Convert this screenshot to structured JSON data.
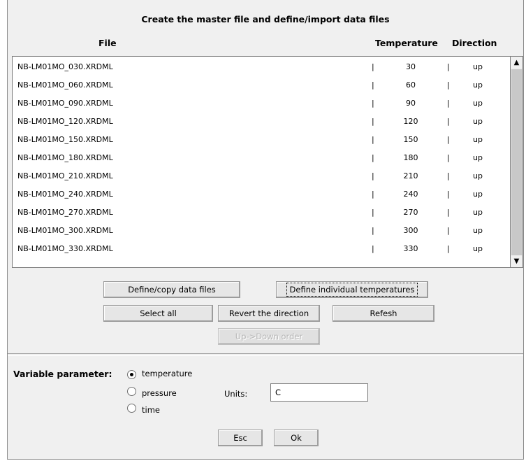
{
  "dialog": {
    "title": "Create the master file and define/import data files",
    "columns": {
      "file": "File",
      "temperature": "Temperature",
      "direction": "Direction"
    }
  },
  "rows": [
    {
      "file": "NB-LM01MO_030.XRDML",
      "temperature": "30",
      "direction": "up"
    },
    {
      "file": "NB-LM01MO_060.XRDML",
      "temperature": "60",
      "direction": "up"
    },
    {
      "file": "NB-LM01MO_090.XRDML",
      "temperature": "90",
      "direction": "up"
    },
    {
      "file": "NB-LM01MO_120.XRDML",
      "temperature": "120",
      "direction": "up"
    },
    {
      "file": "NB-LM01MO_150.XRDML",
      "temperature": "150",
      "direction": "up"
    },
    {
      "file": "NB-LM01MO_180.XRDML",
      "temperature": "180",
      "direction": "up"
    },
    {
      "file": "NB-LM01MO_210.XRDML",
      "temperature": "210",
      "direction": "up"
    },
    {
      "file": "NB-LM01MO_240.XRDML",
      "temperature": "240",
      "direction": "up"
    },
    {
      "file": "NB-LM01MO_270.XRDML",
      "temperature": "270",
      "direction": "up"
    },
    {
      "file": "NB-LM01MO_300.XRDML",
      "temperature": "300",
      "direction": "up"
    },
    {
      "file": "NB-LM01MO_330.XRDML",
      "temperature": "330",
      "direction": "up"
    }
  ],
  "buttons": {
    "define_copy": "Define/copy data files",
    "define_temps": "Define individual temperatures",
    "select_all": "Select all",
    "revert": "Revert the direction",
    "refresh": "Refesh",
    "up_down": "Up->Down order",
    "esc": "Esc",
    "ok": "Ok"
  },
  "variable": {
    "label": "Variable parameter:",
    "options": [
      "temperature",
      "pressure",
      "time"
    ],
    "selected": "temperature",
    "units_label": "Units:",
    "units_value": "C"
  },
  "icons": {
    "scroll_up": "arrow-up-icon",
    "scroll_down": "arrow-down-icon"
  }
}
